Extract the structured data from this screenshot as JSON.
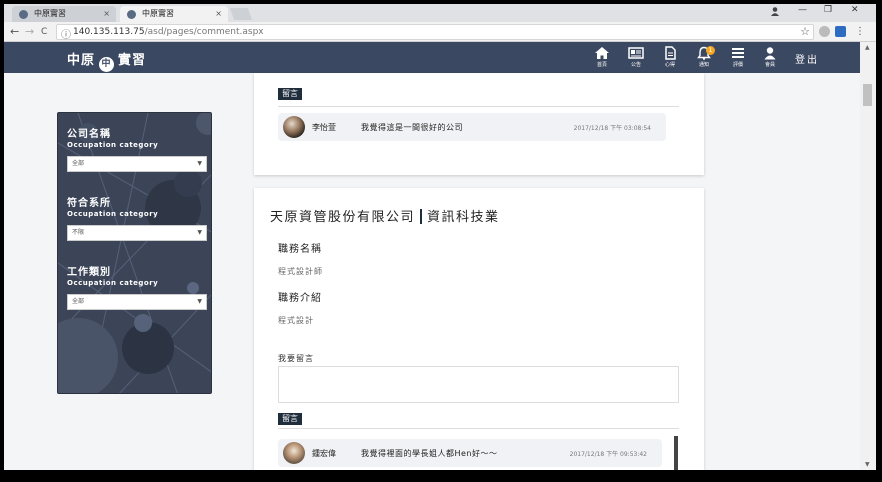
{
  "browser": {
    "tabs": [
      {
        "title": "中原實習",
        "close": "×"
      },
      {
        "title": "中原實習",
        "close": "×"
      }
    ],
    "window_controls": {
      "minimize": "—",
      "restore": "❐",
      "close": "✕"
    },
    "nav": {
      "back": "←",
      "forward": "→",
      "reload": "C"
    },
    "url_host": "140.135.113.75",
    "url_path": "/asd/pages/comment.aspx",
    "star": "☆",
    "menu": "⋮"
  },
  "header": {
    "logo_left": "中原",
    "logo_mark": "中",
    "logo_right": "實習",
    "items": [
      {
        "label": "首頁",
        "icon": "home-icon"
      },
      {
        "label": "公告",
        "icon": "newspaper-icon"
      },
      {
        "label": "心得",
        "icon": "document-icon"
      },
      {
        "label": "通知",
        "icon": "bell-icon",
        "badge": "1"
      },
      {
        "label": "評價",
        "icon": "menu-icon"
      },
      {
        "label": "會員",
        "icon": "user-icon"
      }
    ],
    "logout": "登出"
  },
  "sidebar": {
    "filters": [
      {
        "title": "公司名稱",
        "subtitle": "Occupation category",
        "value": "全部"
      },
      {
        "title": "符合系所",
        "subtitle": "Occupation category",
        "value": "不限"
      },
      {
        "title": "工作類別",
        "subtitle": "Occupation category",
        "value": "全部"
      }
    ]
  },
  "card1": {
    "tag": "留言",
    "comment": {
      "name": "李怡萱",
      "text": "我覺得這是一間很好的公司",
      "time": "2017/12/18 下午 03:08:54"
    }
  },
  "card2": {
    "company": "天原資管股份有限公司",
    "industry": "資訊科技業",
    "job_title_label": "職務名稱",
    "job_title": "程式設計師",
    "job_intro_label": "職務介紹",
    "job_intro": "程式設計",
    "leave_comment_label": "我要留言",
    "tag": "留言",
    "comment": {
      "name": "鍾宏偉",
      "text": "我覺得裡面的學長姐人都Hen好～～",
      "time": "2017/12/18 下午 09:53:42"
    }
  },
  "colors": {
    "navbar": "#3b4861",
    "sidebar": "#3c4558",
    "badge": "#f5a623"
  }
}
